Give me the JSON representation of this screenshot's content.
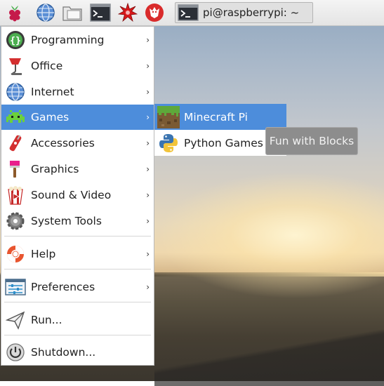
{
  "taskbar": {
    "buttons": [
      {
        "icon": "raspberry-icon"
      },
      {
        "icon": "globe-icon"
      },
      {
        "icon": "folder-icon"
      },
      {
        "icon": "terminal-icon"
      },
      {
        "icon": "mathematica-icon"
      },
      {
        "icon": "wolfram-icon"
      }
    ],
    "task": {
      "label": "pi@raspberrypi: ~",
      "icon": "terminal-icon"
    }
  },
  "menu": {
    "items": [
      {
        "label": "Programming",
        "icon": "programming-icon",
        "has_submenu": true
      },
      {
        "label": "Office",
        "icon": "office-icon",
        "has_submenu": true
      },
      {
        "label": "Internet",
        "icon": "globe-icon",
        "has_submenu": true
      },
      {
        "label": "Games",
        "icon": "games-icon",
        "has_submenu": true,
        "selected": true
      },
      {
        "label": "Accessories",
        "icon": "accessories-icon",
        "has_submenu": true
      },
      {
        "label": "Graphics",
        "icon": "graphics-icon",
        "has_submenu": true
      },
      {
        "label": "Sound & Video",
        "icon": "sound-video-icon",
        "has_submenu": true
      },
      {
        "label": "System Tools",
        "icon": "system-tools-icon",
        "has_submenu": true
      },
      {
        "label": "Help",
        "icon": "help-icon",
        "has_submenu": true
      },
      {
        "label": "Preferences",
        "icon": "preferences-icon",
        "has_submenu": true
      },
      {
        "label": "Run...",
        "icon": "run-icon",
        "has_submenu": false
      },
      {
        "label": "Shutdown...",
        "icon": "shutdown-icon",
        "has_submenu": false
      }
    ],
    "arrow": "›"
  },
  "submenu": {
    "items": [
      {
        "label": "Minecraft Pi",
        "icon": "minecraft-icon",
        "selected": true
      },
      {
        "label": "Python Games",
        "icon": "python-icon"
      }
    ]
  },
  "tooltip": {
    "text": "Fun with Blocks"
  },
  "colors": {
    "selection": "#4d8ddb",
    "menu_bg": "#ffffff",
    "tooltip_bg": "#8d8d8d"
  }
}
